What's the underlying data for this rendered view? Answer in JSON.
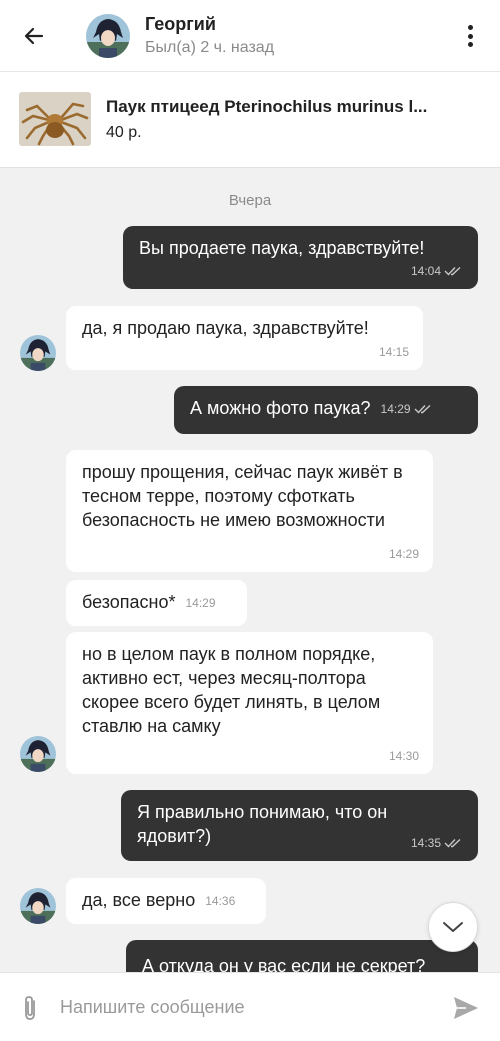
{
  "header": {
    "name": "Георгий",
    "status": "Был(а) 2 ч. назад",
    "icons": {
      "back": "arrow-left-icon",
      "menu": "more-vertical-icon"
    }
  },
  "product": {
    "title": "Паук птицеед Pterinochilus murinus l...",
    "price": "40 р."
  },
  "chat": {
    "date_separator": "Вчера",
    "messages": [
      {
        "dir": "out",
        "text": "Вы продаете паука, здравствуйте!",
        "time": "14:04",
        "read": true
      },
      {
        "dir": "in",
        "text": "да, я продаю паука, здравствуйте!",
        "time": "14:15"
      },
      {
        "dir": "out",
        "text": "А можно фото паука?",
        "time": "14:29",
        "read": true
      },
      {
        "dir": "in",
        "text": "прошу прощения, сейчас паук живёт в тесном терре, поэтому сфоткать безопасность не имею возможности",
        "time": "14:29"
      },
      {
        "dir": "in",
        "text": "безопасно*",
        "time": "14:29"
      },
      {
        "dir": "in",
        "text": "но в целом паук в полном порядке, активно ест, через месяц-полтора скорее всего будет линять, в целом ставлю на самку",
        "time": "14:30"
      },
      {
        "dir": "out",
        "text": "Я правильно понимаю, что он ядовит?)",
        "time": "14:35",
        "read": true
      },
      {
        "dir": "in",
        "text": "да, все верно",
        "time": "14:36"
      },
      {
        "dir": "out",
        "text": "А откуда он у вас если не секрет?",
        "time": ""
      }
    ]
  },
  "composer": {
    "placeholder": "Напишите сообщение",
    "icons": {
      "attach": "paperclip-icon",
      "send": "send-icon",
      "scroll": "chevron-down-icon"
    }
  },
  "colors": {
    "outgoing_bubble": "#333333",
    "incoming_bubble": "#ffffff",
    "chat_background": "#f1f1f1",
    "muted_text": "#8a8a8a"
  }
}
